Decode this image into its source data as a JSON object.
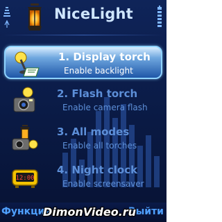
{
  "app": {
    "title": "NiceLight"
  },
  "menu": {
    "items": [
      {
        "title": "1. Display torch",
        "subtitle": "Enable backlight",
        "icon": "desk-lamp-icon",
        "selected": true
      },
      {
        "title": "2. Flash torch",
        "subtitle": "Enable camera flash",
        "icon": "camera-flash-icon",
        "selected": false
      },
      {
        "title": "3. All modes",
        "subtitle": "Enable all torches",
        "icon": "all-modes-icon",
        "selected": false
      },
      {
        "title": "4. Night clock",
        "subtitle": "Enable screensaver",
        "icon": "alarm-clock-icon",
        "selected": false
      }
    ]
  },
  "softkeys": {
    "left": "Функции",
    "right": "Выйти"
  },
  "watermark": {
    "text": "DimonVideo.ru"
  },
  "colors": {
    "accent": "#4fa0ff",
    "selection": "#1f57a8",
    "background": "#0a1a44"
  }
}
